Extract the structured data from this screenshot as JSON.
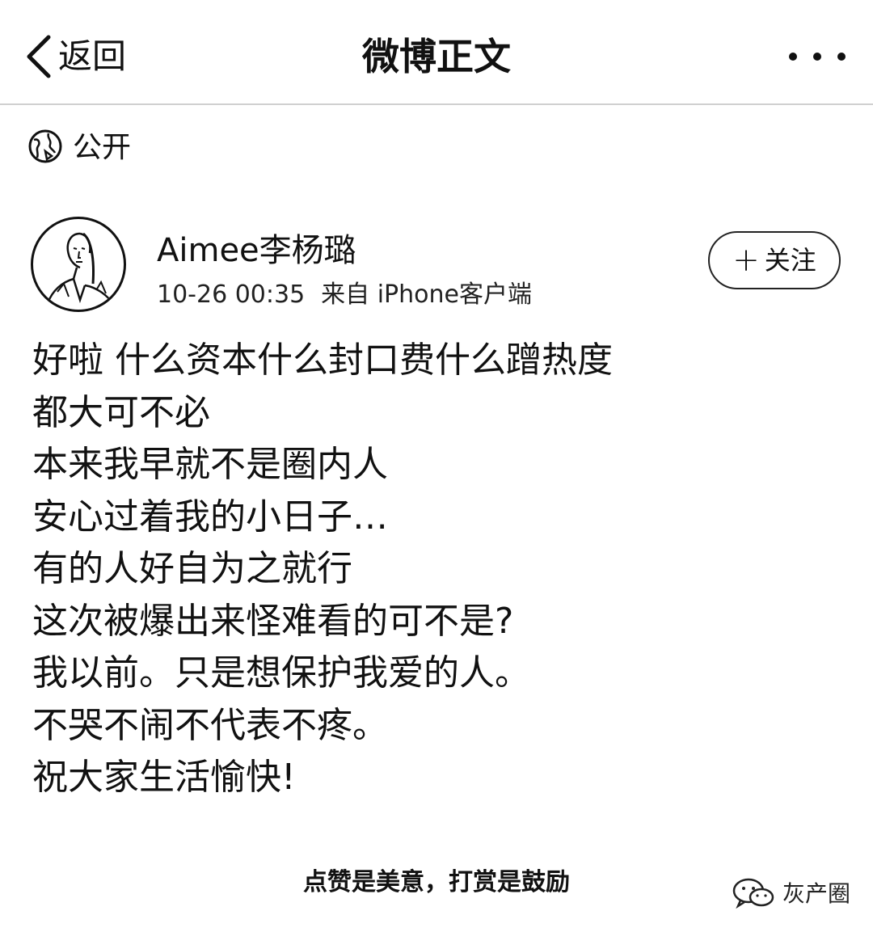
{
  "nav": {
    "back_label": "返回",
    "title": "微博正文",
    "more_icon": "more-icon"
  },
  "visibility": {
    "icon": "globe-icon",
    "label": "公开"
  },
  "author": {
    "name": "Aimee李杨璐",
    "time": "10-26 00:35",
    "source": "来自 iPhone客户端",
    "follow_label": "关注"
  },
  "post": {
    "lines": [
      "好啦 什么资本什么封口费什么蹭热度",
      "都大可不必",
      "本来我早就不是圈内人",
      "安心过着我的小日子…",
      "有的人好自为之就行",
      "这次被爆出来怪难看的可不是?",
      "我以前。只是想保护我爱的人。",
      "不哭不闹不代表不疼。",
      "祝大家生活愉快!"
    ]
  },
  "footer": {
    "note": "点赞是美意，打赏是鼓励",
    "watermark": "灰产圈"
  }
}
